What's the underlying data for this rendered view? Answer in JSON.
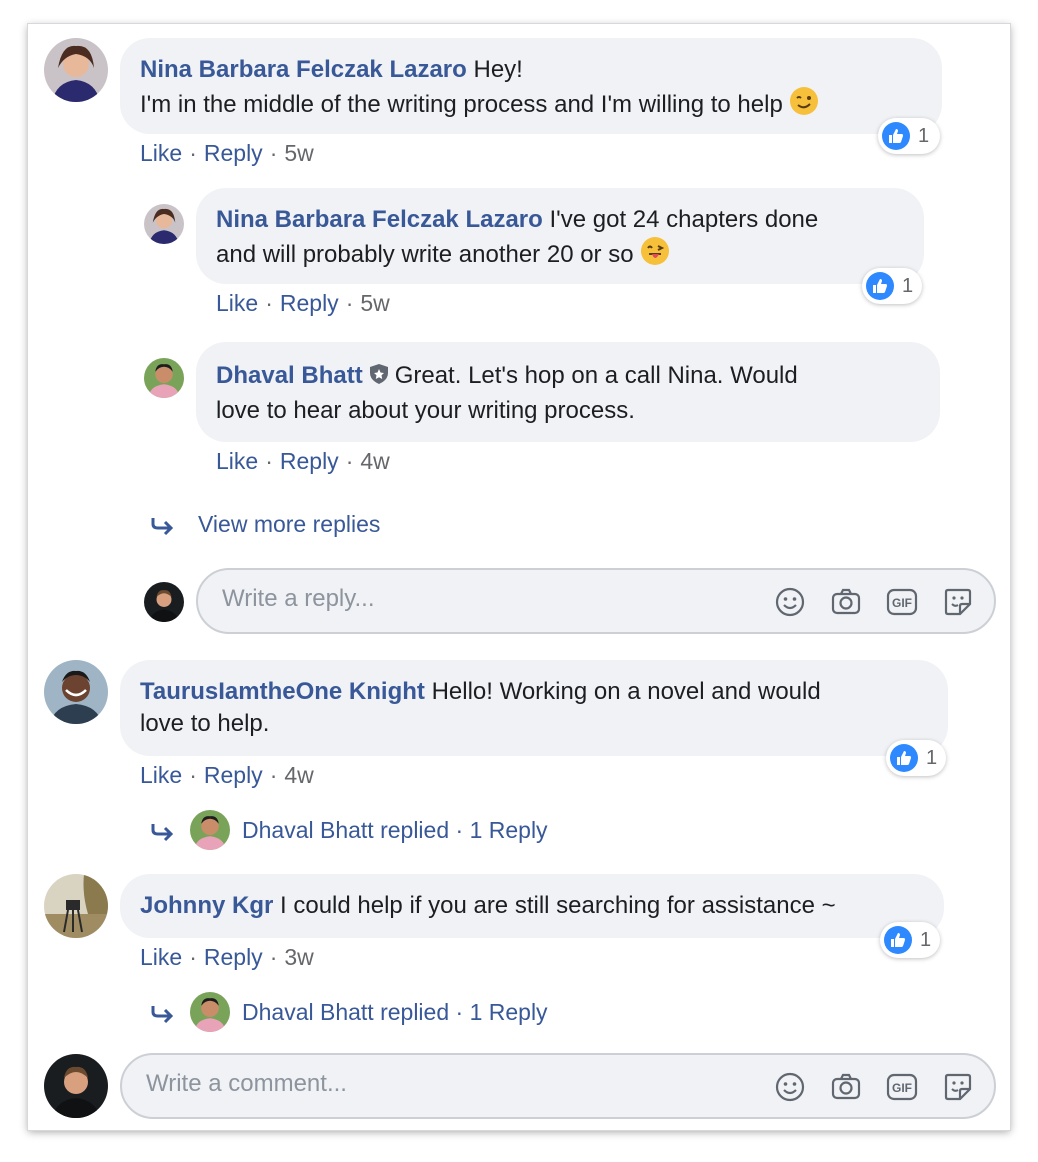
{
  "comments": [
    {
      "author": "Nina Barbara Felczak Lazaro",
      "text_line1": "Hey!",
      "text_line2": "I'm in the middle of the writing process and I'm willing to help",
      "like": "Like",
      "reply": "Reply",
      "time": "5w",
      "reactions": "1",
      "replies": [
        {
          "author": "Nina Barbara Felczak Lazaro",
          "text_line1": "I've got 24 chapters done",
          "text_line2": "and will probably write another 20 or so",
          "like": "Like",
          "reply": "Reply",
          "time": "5w",
          "reactions": "1"
        },
        {
          "author": "Dhaval Bhatt",
          "text_line1": "Great. Let's hop on a call Nina. Would",
          "text_line2": "love to hear about your writing process.",
          "like": "Like",
          "reply": "Reply",
          "time": "4w"
        }
      ],
      "view_more": "View more replies",
      "reply_placeholder": "Write a reply..."
    },
    {
      "author": "TaurusIamtheOne Knight",
      "text_line1": "Hello! Working on a novel and would",
      "text_line2": "love to help.",
      "like": "Like",
      "reply": "Reply",
      "time": "4w",
      "reactions": "1",
      "replied_summary": "Dhaval Bhatt replied · 1 Reply"
    },
    {
      "author": "Johnny Kgr",
      "text_line1": "I could help if you are still searching for assistance ~",
      "like": "Like",
      "reply": "Reply",
      "time": "3w",
      "reactions": "1",
      "replied_summary": "Dhaval Bhatt replied · 1 Reply"
    }
  ],
  "comment_placeholder": "Write a comment...",
  "separator": "·",
  "icons": [
    "smiley-icon",
    "camera-icon",
    "gif-icon",
    "sticker-icon",
    "like-thumb-icon",
    "reply-arrow-icon",
    "shield-icon",
    "wink-emoji-icon",
    "tongue-emoji-icon"
  ],
  "colors": {
    "link": "#385898",
    "bubble": "#f0f2f5",
    "like": "#2e89ff",
    "muted": "#65676b"
  }
}
